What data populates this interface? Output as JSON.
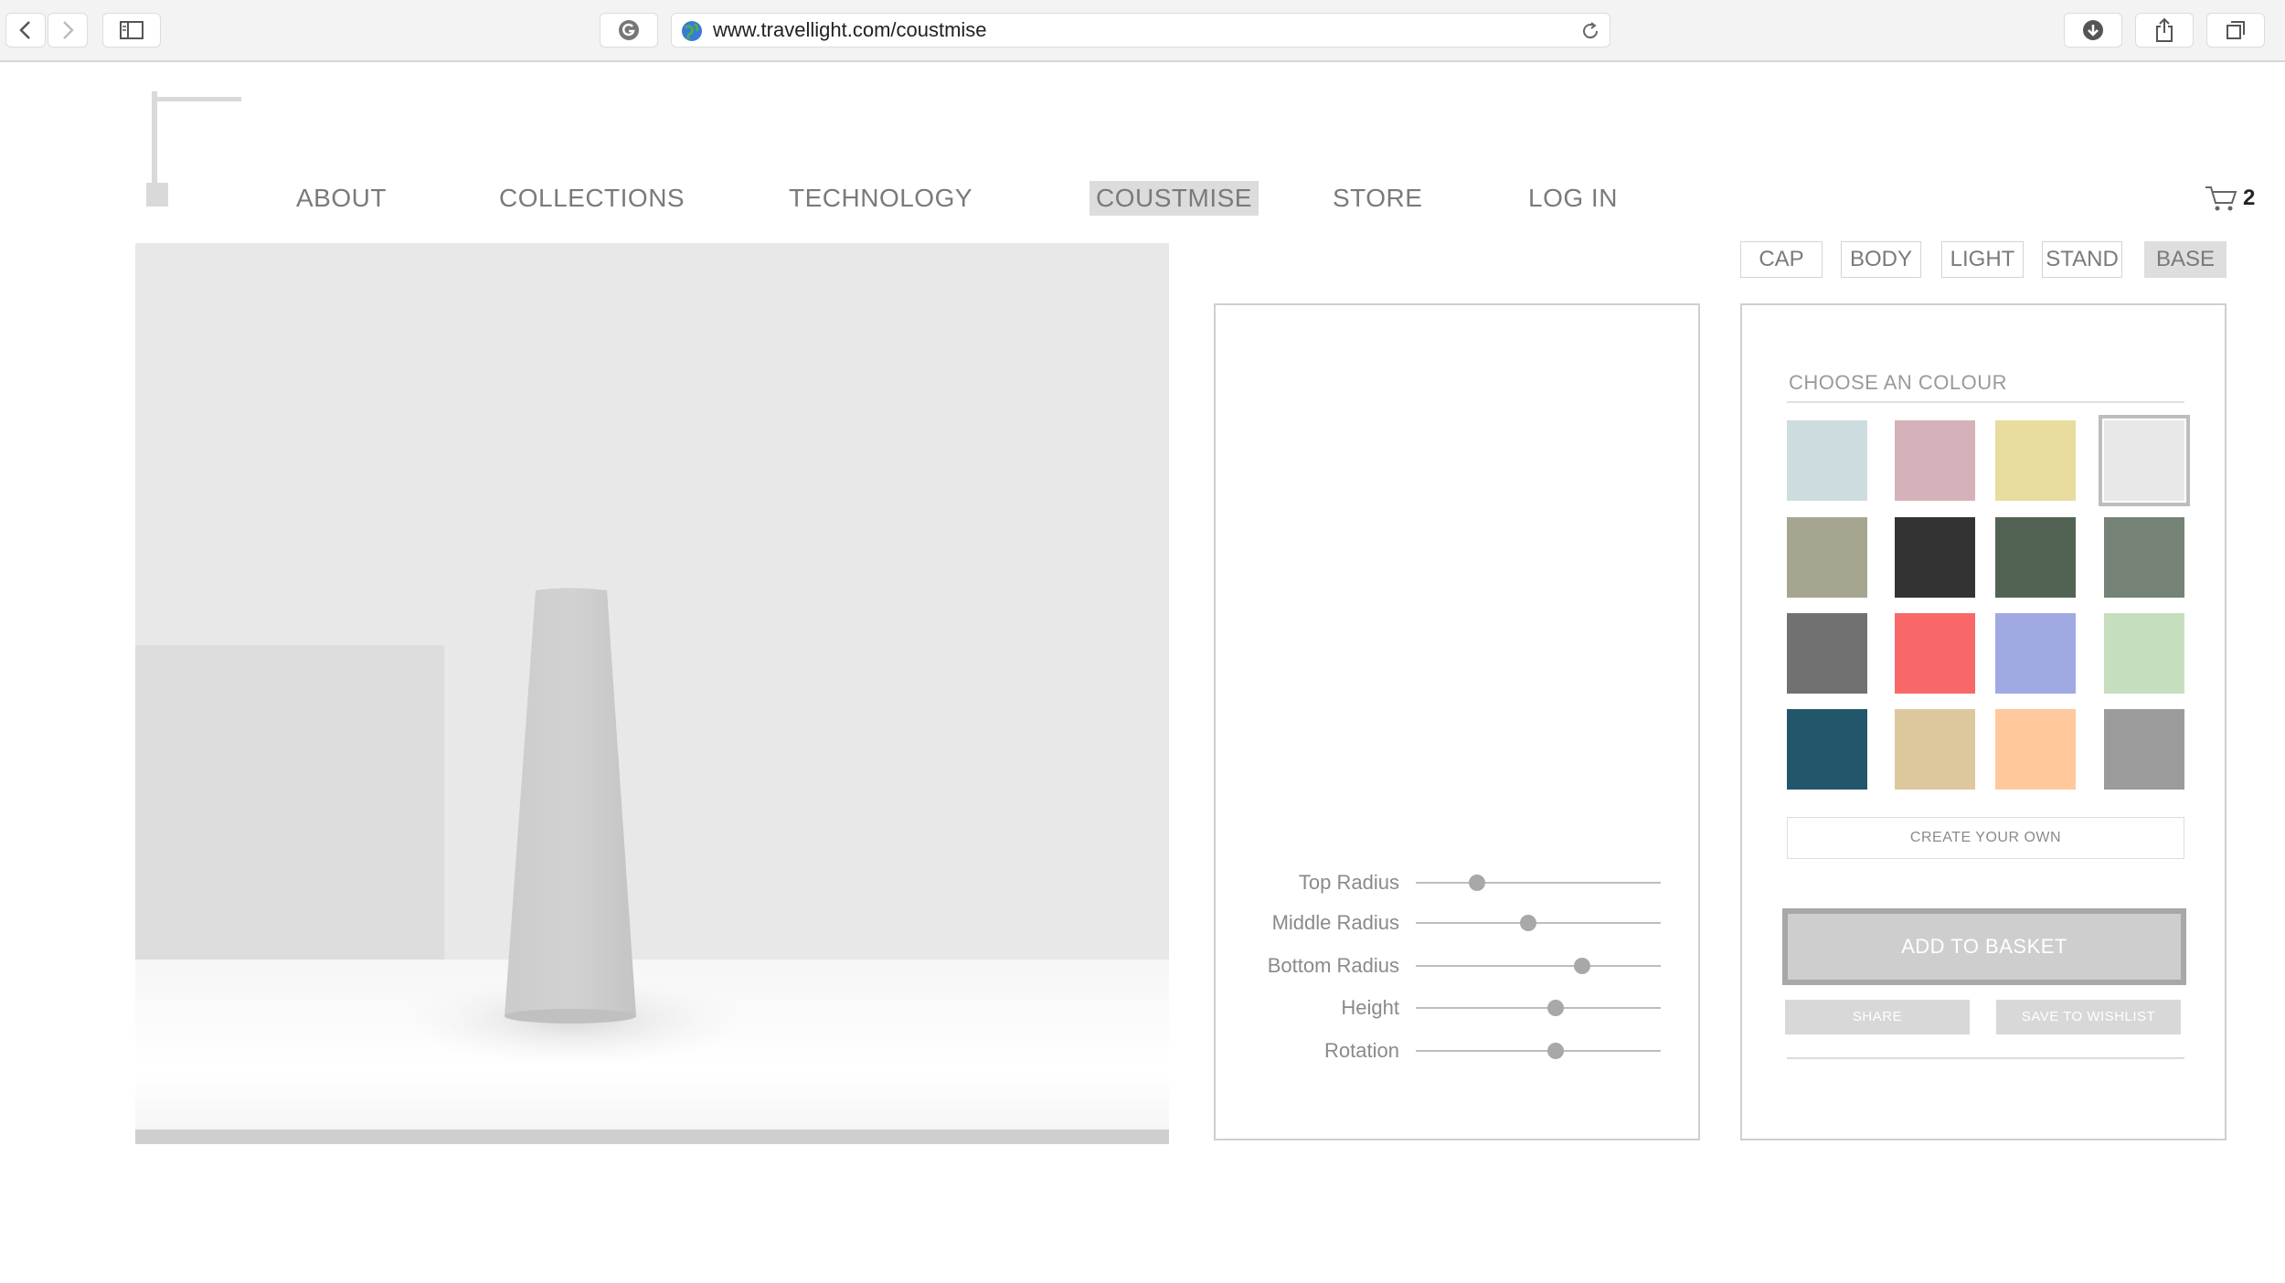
{
  "browser": {
    "url": "www.travellight.com/coustmise"
  },
  "nav": {
    "items": [
      {
        "label": "ABOUT"
      },
      {
        "label": "COLLECTIONS"
      },
      {
        "label": "TECHNOLOGY"
      },
      {
        "label": "COUSTMISE"
      },
      {
        "label": "STORE"
      },
      {
        "label": "LOG IN"
      }
    ],
    "active": "COUSTMISE"
  },
  "cart": {
    "count": "2"
  },
  "parts": {
    "tabs": [
      {
        "label": "CAP"
      },
      {
        "label": "BODY"
      },
      {
        "label": "LIGHT"
      },
      {
        "label": "STAND"
      },
      {
        "label": "BASE"
      }
    ],
    "active": "BASE"
  },
  "sliders": [
    {
      "label": "Top Radius",
      "value": 0.25
    },
    {
      "label": "Middle Radius",
      "value": 0.46
    },
    {
      "label": "Bottom Radius",
      "value": 0.68
    },
    {
      "label": "Height",
      "value": 0.57
    },
    {
      "label": "Rotation",
      "value": 0.57
    }
  ],
  "colour": {
    "heading": "CHOOSE AN COLOUR",
    "swatches": [
      "#cddcde",
      "#d5b2b9",
      "#e8dc9e",
      "#e8e8e8",
      "#a6a58f",
      "#333333",
      "#536353",
      "#748376",
      "#717171",
      "#f86868",
      "#a1a9e2",
      "#c5dfbe",
      "#22566b",
      "#ddc89d",
      "#ffc99d",
      "#9b9b9b"
    ],
    "selected_index": 3,
    "create_label": "CREATE YOUR OWN"
  },
  "actions": {
    "add_to_basket": "ADD TO BASKET",
    "share": "SHARE",
    "save_to_wishlist": "SAVE TO WISHLIST"
  }
}
